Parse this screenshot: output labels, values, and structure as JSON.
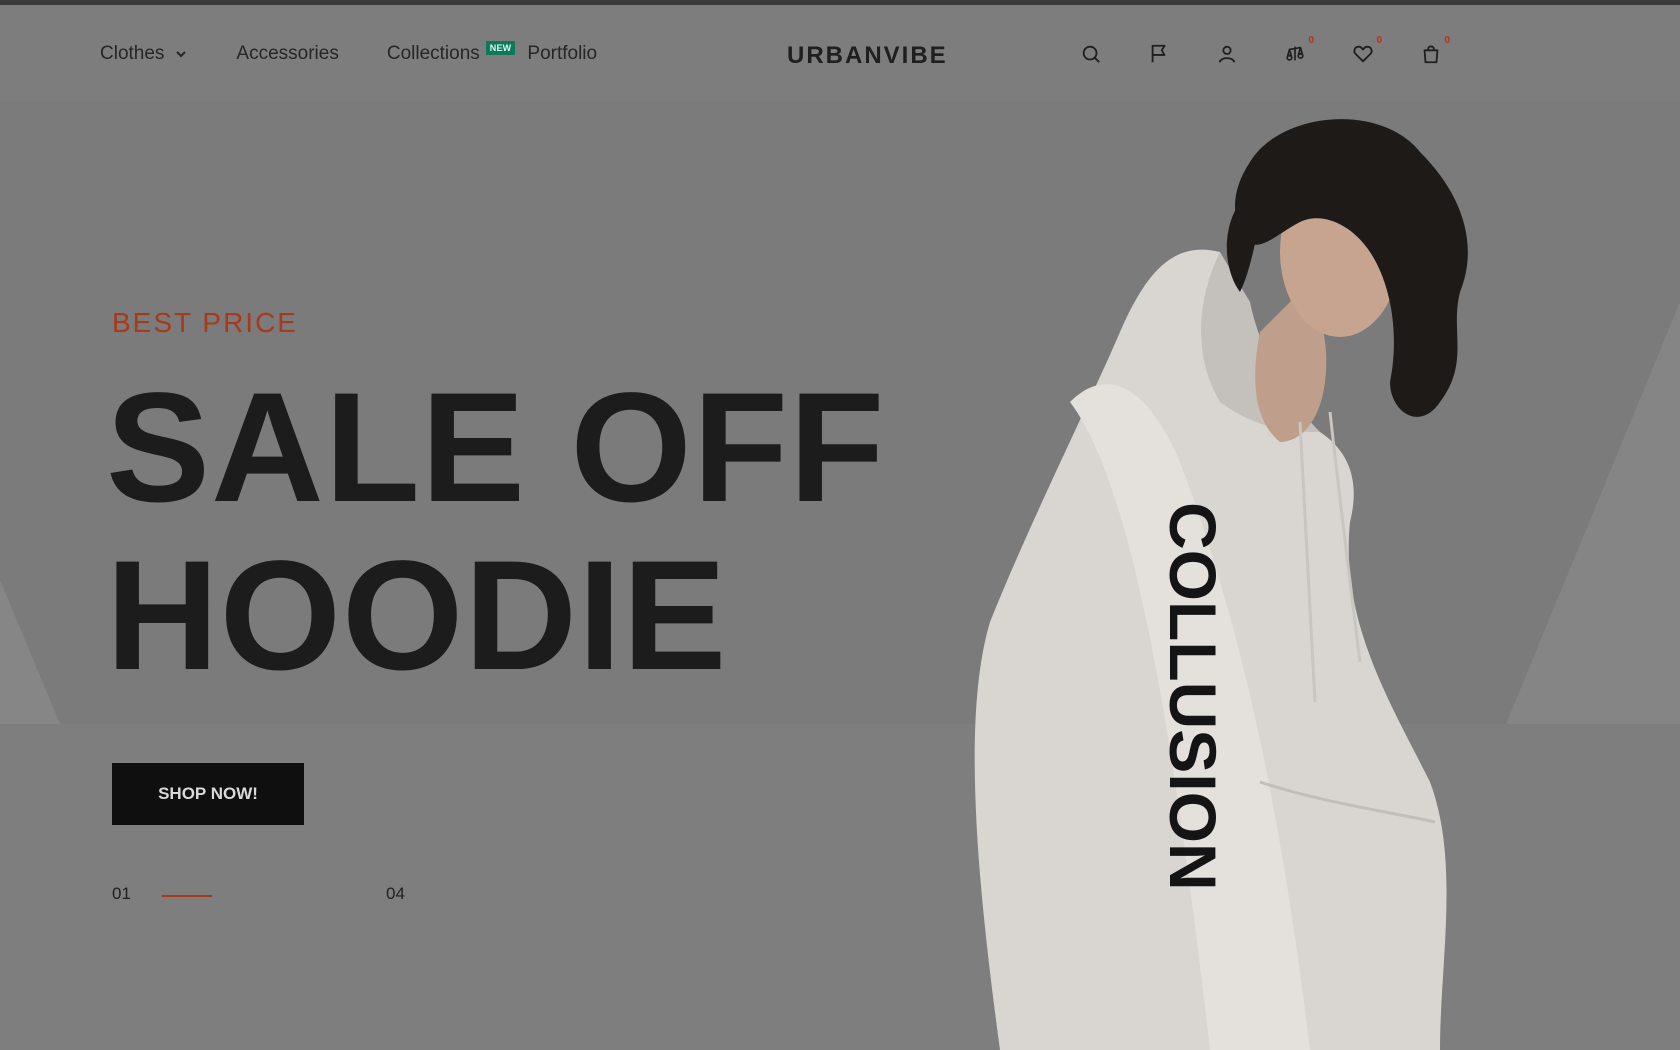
{
  "header": {
    "nav": [
      {
        "label": "Clothes"
      },
      {
        "label": "Accessories"
      },
      {
        "label": "Collections",
        "badge": "NEW"
      },
      {
        "label": "Portfolio"
      }
    ],
    "logo": "URBANVIBE",
    "icons": {
      "compare_count": "0",
      "wishlist_count": "0",
      "cart_count": "0"
    }
  },
  "hero": {
    "kicker": "BEST PRICE",
    "headline_line1": "SALE OFF",
    "headline_line2": "HOODIE",
    "cta": "SHOP NOW!",
    "slide_current": "01",
    "slide_total": "04",
    "slide_progress": 0.25,
    "image_text": "COLLUSION"
  },
  "colors": {
    "accent": "#a8391a",
    "badge": "#0c7a5a",
    "text_dark": "#1c1c1c"
  }
}
